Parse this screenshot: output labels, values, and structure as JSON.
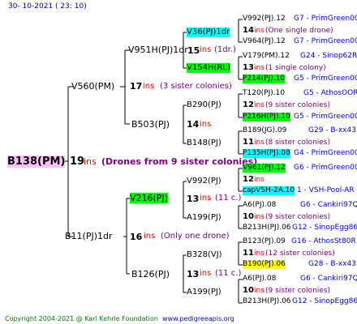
{
  "header": {
    "date": "30- 10-2021 ( 23: 10)"
  },
  "root": {
    "name": "B138(PM)",
    "ins_num": "19",
    "ins_word": "ins",
    "note": "(Drones from 9 sister colonies)"
  },
  "gen1": [
    {
      "name": "V560(PM)"
    },
    {
      "name": "B11(PJ)1dr",
      "ins_num": "16",
      "ins_word": "ins",
      "note": "(Only one drone)"
    }
  ],
  "gen2": [
    {
      "name": "V951H(PJ)1dr",
      "ins_num": "15",
      "ins_word": "ins",
      "note": "(1dr.)"
    },
    {
      "name": "B503(PJ)",
      "ins_num": "14",
      "ins_word": "ins"
    },
    {
      "name": "V216(PJ)",
      "ins_num": "13",
      "ins_word": "ins",
      "note": "(11 c.)"
    },
    {
      "name": "B126(PJ)",
      "ins_num": "13",
      "ins_word": "ins",
      "note": "(11 c.)"
    }
  ],
  "mid_note": {
    "ins_num": "17",
    "ins_word": "ins",
    "note": "(3 sister colonies)"
  },
  "gen3": [
    {
      "name": "V36(PJ)1dr"
    },
    {
      "name": "V154H(RL)"
    },
    {
      "name": "B290(PJ)"
    },
    {
      "name": "B148(PJ)"
    },
    {
      "name": "V992(PJ)"
    },
    {
      "name": "A199(PJ)"
    },
    {
      "name": "B328(VJ)"
    },
    {
      "name": "A199(PJ)"
    }
  ],
  "gen4": [
    {
      "left": "V992(PJ).12",
      "right": "G7 - PrimGreen00"
    },
    {
      "num": "14",
      "ins": "ins",
      "note": "(One single drone)"
    },
    {
      "left": "V964(PJ).12",
      "right": "G7 - PrimGreen00"
    },
    {
      "left": "V179(PM).12",
      "right": "G24 - Sinop62R"
    },
    {
      "num": "13",
      "ins": "ins",
      "note": "(1 single colony)"
    },
    {
      "left": "P214(PJ).10",
      "right": "G5 - PrimGreen00"
    },
    {
      "left": "T120(PJ).10",
      "right": "G5 - AthosOOR"
    },
    {
      "num": "12",
      "ins": "ins",
      "note": "(9 sister colonies)"
    },
    {
      "left": "P216H(PJ).10",
      "right": "G5 - PrimGreen00"
    },
    {
      "left": "B189(JG).09",
      "right": "G29 - B-xx43"
    },
    {
      "num": "11",
      "ins": "ins",
      "note": "(8 sister colonies)"
    },
    {
      "left": "P135H(PJ).08",
      "right": "G4 - PrimGreen00"
    },
    {
      "left": "V961(PJ).12",
      "right": "G6 - PrimGreen00"
    },
    {
      "num": "12",
      "ins": "ins"
    },
    {
      "left": "capVSH-2A.10",
      "right": "1 - VSH-Pool-AR"
    },
    {
      "left": "A6(PJ).08",
      "right": "G6 - Cankiri97Q"
    },
    {
      "num": "10",
      "ins": "ins",
      "note": "(9 sister colonies)"
    },
    {
      "left": "B213H(PJ).06",
      "right": "G12 - SinopEgg86R"
    },
    {
      "left": "B123(PJ).09",
      "right": "G16 - AthosSt80R"
    },
    {
      "num": "11",
      "ins": "ins",
      "note": "(12 sister colonies)"
    },
    {
      "left": "B190(PJ).06",
      "right": "G28 - B-xx43"
    },
    {
      "left": "A6(PJ).08",
      "right": "G6 - Cankiri97Q"
    },
    {
      "num": "10",
      "ins": "ins",
      "note": "(9 sister colonies)"
    },
    {
      "left": "B213H(PJ).06",
      "right": "G12 - SinopEgg86R"
    }
  ],
  "footer": {
    "copyright": "Copyright 2004-2021 @ Karl Kehrle Foundation",
    "site": "www.pedigreeapis.org"
  }
}
